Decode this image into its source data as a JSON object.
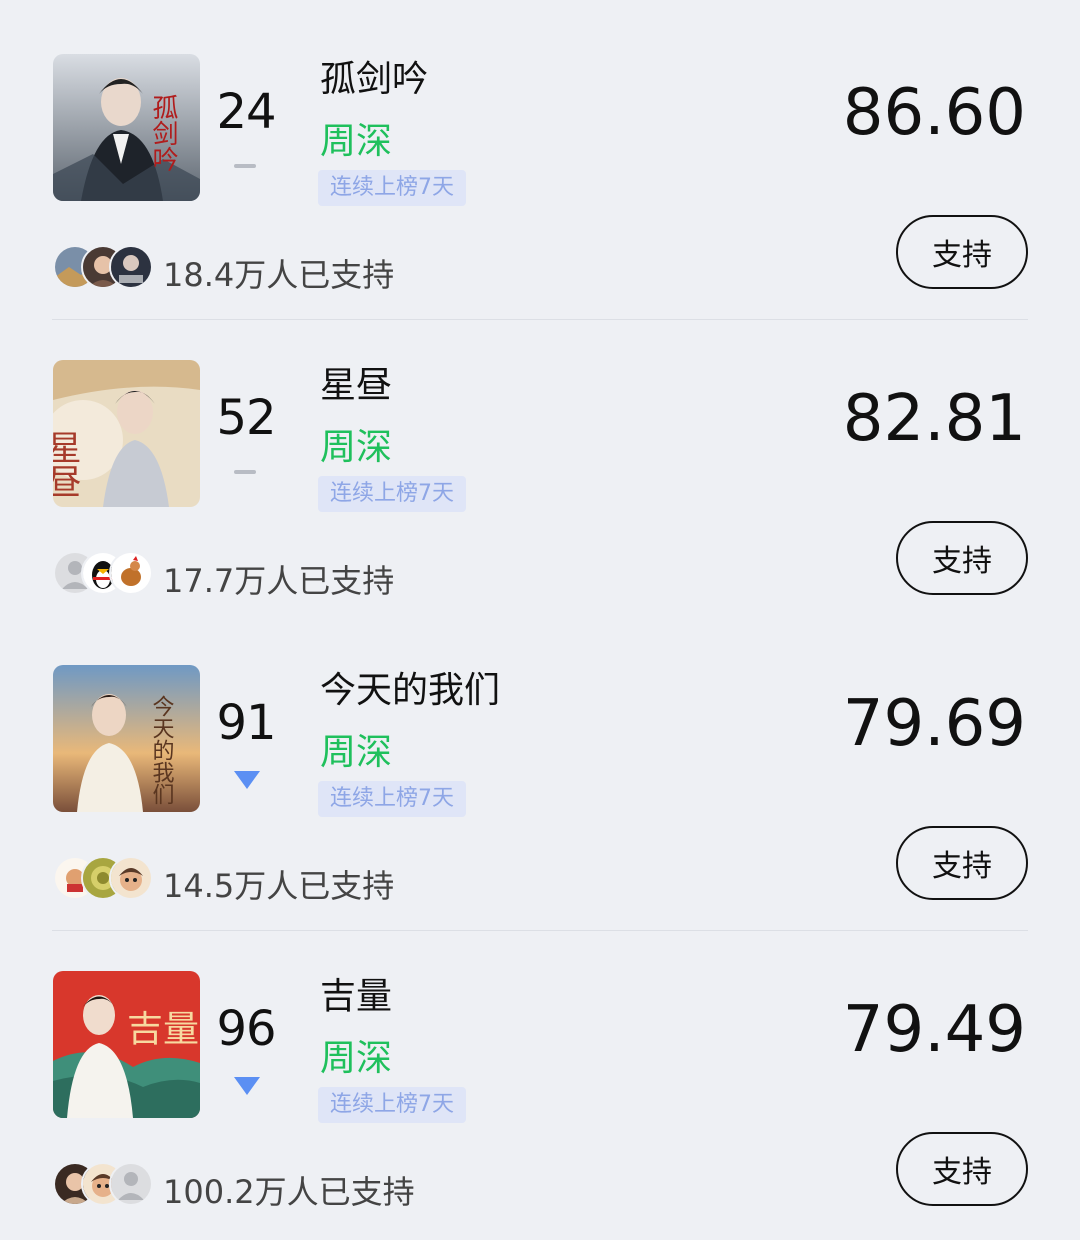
{
  "items": [
    {
      "rank": "24",
      "trend": "flat",
      "song": "孤剑吟",
      "artist": "周深",
      "badge": "连续上榜7天",
      "score": "86.60",
      "supporters": "18.4万人已支持",
      "button": "支持",
      "cover_text": "孤剑吟"
    },
    {
      "rank": "52",
      "trend": "flat",
      "song": "星昼",
      "artist": "周深",
      "badge": "连续上榜7天",
      "score": "82.81",
      "supporters": "17.7万人已支持",
      "button": "支持",
      "cover_text": "星昼"
    },
    {
      "rank": "91",
      "trend": "down",
      "song": "今天的我们",
      "artist": "周深",
      "badge": "连续上榜7天",
      "score": "79.69",
      "supporters": "14.5万人已支持",
      "button": "支持",
      "cover_text": "今天的我们"
    },
    {
      "rank": "96",
      "trend": "down",
      "song": "吉量",
      "artist": "周深",
      "badge": "连续上榜7天",
      "score": "79.49",
      "supporters": "100.2万人已支持",
      "button": "支持",
      "cover_text": "吉量"
    }
  ],
  "colors": {
    "background": "#eef0f4",
    "artist": "#1fc05c",
    "badge_bg": "#dfe5f7",
    "badge_text": "#8ea6e6",
    "trend_down": "#5b8ff3"
  }
}
